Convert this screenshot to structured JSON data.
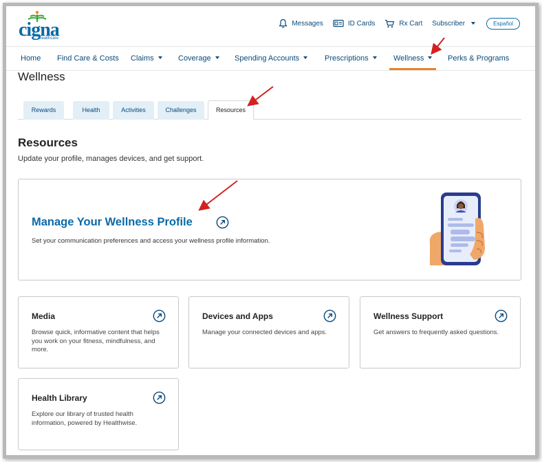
{
  "header": {
    "logo_text": "cigna",
    "logo_sub": "healthcare",
    "utilities": {
      "messages": "Messages",
      "id_cards": "ID Cards",
      "rx_cart": "Rx Cart",
      "subscriber": "Subscriber",
      "language": "Español"
    }
  },
  "nav": {
    "items": [
      {
        "label": "Home"
      },
      {
        "label": "Find Care & Costs"
      },
      {
        "label": "Claims"
      },
      {
        "label": "Coverage"
      },
      {
        "label": "Spending Accounts"
      },
      {
        "label": "Prescriptions"
      },
      {
        "label": "Wellness"
      },
      {
        "label": "Perks & Programs"
      }
    ],
    "active": "Wellness"
  },
  "page": {
    "title": "Wellness"
  },
  "tabs": {
    "items": [
      {
        "label": "Rewards"
      },
      {
        "label": "Health"
      },
      {
        "label": "Activities"
      },
      {
        "label": "Challenges"
      },
      {
        "label": "Resources"
      }
    ],
    "active": "Resources"
  },
  "resources": {
    "title": "Resources",
    "description": "Update your profile, manages devices, and get support.",
    "hero": {
      "title": "Manage Your Wellness Profile",
      "description": "Set your communication preferences and access your wellness profile information."
    },
    "cards": [
      {
        "title": "Media",
        "description": "Browse quick, informative content that helps you work on your fitness, mindfulness, and more."
      },
      {
        "title": "Devices and Apps",
        "description": "Manage your connected devices and apps."
      },
      {
        "title": "Wellness Support",
        "description": "Get answers to frequently asked questions."
      },
      {
        "title": "Health Library",
        "description": "Explore our library of trusted health information, powered by Healthwise."
      }
    ]
  },
  "colors": {
    "brand_blue": "#0a6aa8",
    "nav_text": "#0a4a7a",
    "active_underline": "#e8832a",
    "tab_bg": "#e3eff7",
    "annotation_red": "#d42020",
    "logo_green": "#3aa63a",
    "logo_orange": "#f08a1c"
  },
  "icons": {
    "messages": "bell-icon",
    "id_cards": "id-card-icon",
    "rx_cart": "cart-icon",
    "card_link": "arrow-up-right-circle-icon"
  }
}
